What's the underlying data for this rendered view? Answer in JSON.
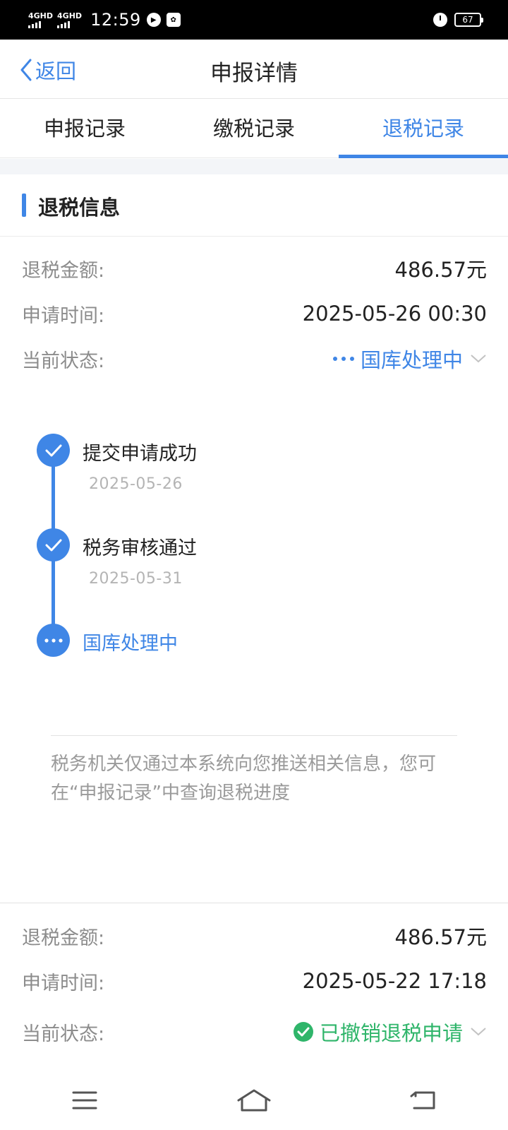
{
  "status_bar": {
    "network1": "4GHD",
    "network2": "4GHD",
    "time": "12:59",
    "battery": "67"
  },
  "header": {
    "back_label": "返回",
    "title": "申报详情"
  },
  "tabs": [
    {
      "label": "申报记录",
      "active": false
    },
    {
      "label": "缴税记录",
      "active": false
    },
    {
      "label": "退税记录",
      "active": true
    }
  ],
  "section": {
    "title": "退税信息"
  },
  "record1": {
    "amount_label": "退税金额:",
    "amount": "486.57元",
    "time_label": "申请时间:",
    "time": "2025-05-26 00:30",
    "status_label": "当前状态:",
    "status": "国库处理中",
    "status_color": "#3f86e6"
  },
  "timeline": [
    {
      "title": "提交申请成功",
      "date": "2025-05-26",
      "state": "done"
    },
    {
      "title": "税务审核通过",
      "date": "2025-05-31",
      "state": "done"
    },
    {
      "title": "国库处理中",
      "date": "",
      "state": "pending"
    }
  ],
  "note": "税务机关仅通过本系统向您推送相关信息，您可在“申报记录”中查询退税进度",
  "record2": {
    "amount_label": "退税金额:",
    "amount": "486.57元",
    "time_label": "申请时间:",
    "time": "2025-05-22 17:18",
    "status_label": "当前状态:",
    "status": "已撤销退税申请",
    "status_color": "#2fb56a"
  },
  "colors": {
    "accent": "#3f86e6",
    "success": "#2fb56a"
  }
}
